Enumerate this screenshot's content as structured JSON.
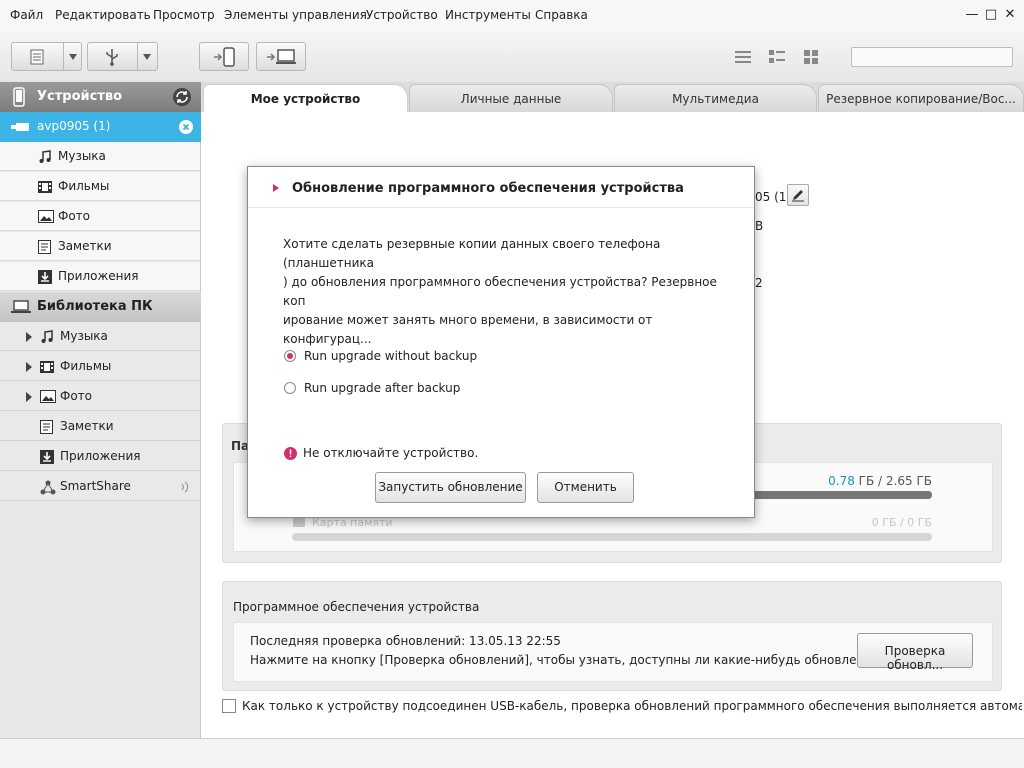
{
  "menu": [
    "Файл",
    "Редактировать",
    "Просмотр",
    "Элементы управления",
    "Устройство",
    "Инструменты",
    "Справка"
  ],
  "window_controls": {
    "minimize": "—",
    "maximize": "□",
    "close": "✕"
  },
  "sidebar": {
    "device_header": "Устройство",
    "device_name": "avp0905 (1)",
    "device_items": [
      "Музыка",
      "Фильмы",
      "Фото",
      "Заметки",
      "Приложения"
    ],
    "pc_header": "Библиотека ПК",
    "pc_items": [
      "Музыка",
      "Фильмы",
      "Фото",
      "Заметки",
      "Приложения",
      "SmartShare"
    ]
  },
  "tabs": [
    "Мое устройство",
    "Личные данные",
    "Мультимедиа",
    "Резервное копирование/Вос..."
  ],
  "content": {
    "device_name_partial": "05 (1)",
    "info_partial_1": "B",
    "info_partial_2": "2",
    "memory_panel_partial": "Па",
    "storage": {
      "used": "0.78",
      "used_unit": " ГБ / ",
      "total": "2.65 ГБ",
      "fill": 0.294
    },
    "sdcard": {
      "label": "Карта памяти",
      "value": "0 ГБ / 0 ГБ",
      "fill": 0
    },
    "software": {
      "title": "Программное обеспечения устройства",
      "last_check": "Последняя проверка обновлений: 13.05.13 22:55",
      "hint": "Нажмите на кнопку [Проверка обновлений], чтобы узнать, доступны ли какие-нибудь обновления.",
      "check_button": "Проверка обновл..."
    },
    "auto_check": "Как только к устройству подсоединен USB-кабель, проверка обновлений программного обеспечения выполняется автоматиче"
  },
  "dialog": {
    "title": "Обновление программного обеспечения устройства",
    "message": "Хотите сделать резервные копии данных своего телефона (планшетника ) до обновления программного обеспечения устройства? Резервное коп ирование может занять много времени, в зависимости от конфигурац...",
    "message_lines": [
      "Хотите сделать резервные копии данных своего телефона (планшетника",
      ") до обновления программного обеспечения устройства? Резервное коп",
      "ирование может занять много времени, в зависимости от конфигурац..."
    ],
    "options": [
      "Run upgrade without backup",
      "Run upgrade after backup"
    ],
    "selected_option": 0,
    "warning": "Не отключайте устройство.",
    "run_button": "Запустить обновление",
    "cancel_button": "Отменить"
  },
  "colors": {
    "accent": "#3cb4e6",
    "dialog_accent": "#d3306b",
    "highlight_value": "#1a8fd0"
  }
}
